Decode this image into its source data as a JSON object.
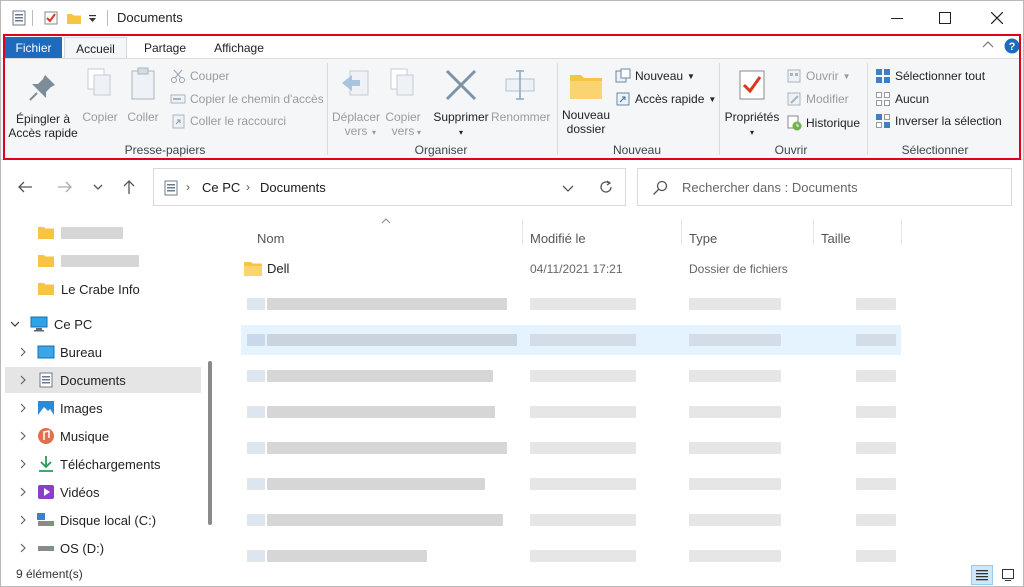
{
  "title": "Documents",
  "tabs": {
    "file": "Fichier",
    "home": "Accueil",
    "share": "Partage",
    "view": "Affichage"
  },
  "ribbon": {
    "pin": "Épingler à\nAccès rapide",
    "copy": "Copier",
    "paste": "Coller",
    "cut": "Couper",
    "copy_path": "Copier le chemin d'accès",
    "paste_shortcut": "Coller le raccourci",
    "clipboard_label": "Presse-papiers",
    "move_to": "Déplacer\nvers",
    "copy_to": "Copier\nvers",
    "delete": "Supprimer",
    "rename": "Renommer",
    "organize_label": "Organiser",
    "new_folder": "Nouveau\ndossier",
    "new_item": "Nouveau",
    "easy_access": "Accès rapide",
    "new_label": "Nouveau",
    "properties": "Propriétés",
    "open": "Ouvrir",
    "edit": "Modifier",
    "history": "Historique",
    "open_label": "Ouvrir",
    "select_all": "Sélectionner tout",
    "select_none": "Aucun",
    "invert_selection": "Inverser la sélection",
    "select_label": "Sélectionner"
  },
  "address": {
    "root": "Ce PC",
    "folder": "Documents"
  },
  "search": {
    "placeholder": "Rechercher dans : Documents"
  },
  "nav": {
    "quick_item": "Le Crabe Info",
    "this_pc": "Ce PC",
    "desktop": "Bureau",
    "documents": "Documents",
    "pictures": "Images",
    "music": "Musique",
    "downloads": "Téléchargements",
    "videos": "Vidéos",
    "local_disk": "Disque local (C:)",
    "os_disk": "OS (D:)"
  },
  "columns": {
    "name": "Nom",
    "modified": "Modifié le",
    "type": "Type",
    "size": "Taille"
  },
  "files": [
    {
      "name": "Dell",
      "modified": "04/11/2021 17:21",
      "type": "Dossier de fichiers"
    }
  ],
  "status": {
    "count": "9 élément(s)"
  },
  "colors": {
    "accent": "#1e6bbd",
    "highlight_frame": "#e0001b",
    "selection": "#e5f3ff",
    "folder": "#f7c443"
  }
}
